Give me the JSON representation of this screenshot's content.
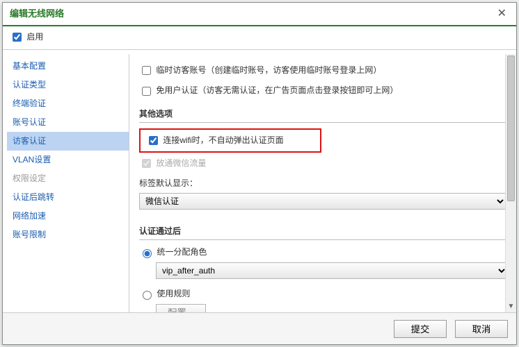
{
  "title": "编辑无线网络",
  "enable_label": "启用",
  "enable_checked": true,
  "sidebar": {
    "items": [
      {
        "label": "基本配置",
        "key": "basic"
      },
      {
        "label": "认证类型",
        "key": "authtype"
      },
      {
        "label": "终端验证",
        "key": "terminal"
      },
      {
        "label": "账号认证",
        "key": "account"
      },
      {
        "label": "访客认证",
        "key": "guest",
        "active": true
      },
      {
        "label": "VLAN设置",
        "key": "vlan"
      },
      {
        "label": "权限设定",
        "key": "perm",
        "disabled": true
      },
      {
        "label": "认证后跳转",
        "key": "redirect"
      },
      {
        "label": "网络加速",
        "key": "accel"
      },
      {
        "label": "账号限制",
        "key": "limit"
      }
    ]
  },
  "guest": {
    "temp_account": {
      "checked": false,
      "label": "临时访客账号（创建临时账号，访客使用临时账号登录上网）"
    },
    "free_auth": {
      "checked": false,
      "label": "免用户认证（访客无需认证，在广告页面点击登录按钮即可上网）"
    },
    "other_title": "其他选项",
    "no_popup": {
      "checked": true,
      "label": "连接wifi时，不自动弹出认证页面"
    },
    "wechat_flow": {
      "checked": true,
      "label": "放通微信流量"
    },
    "default_tag_label": "标签默认显示：",
    "default_tag_value": "微信认证",
    "after_auth_title": "认证通过后",
    "role_radio": {
      "selected": "role",
      "role_label": "统一分配角色",
      "rule_label": "使用规则"
    },
    "role_select": "vip_after_auth",
    "rule_button": "配置..."
  },
  "footer": {
    "submit": "提交",
    "cancel": "取消"
  }
}
